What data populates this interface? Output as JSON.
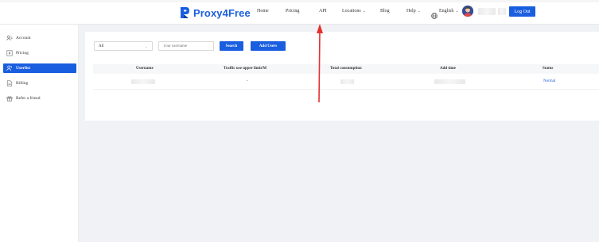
{
  "header": {
    "logo_text": "Proxy4Free",
    "nav": [
      {
        "label": "Home"
      },
      {
        "label": "Pricing"
      },
      {
        "label": "API"
      },
      {
        "label": "Locations"
      },
      {
        "label": "Blog"
      },
      {
        "label": "Help"
      }
    ],
    "language": "English",
    "logout_label": "Log Out"
  },
  "sidebar": {
    "items": [
      {
        "label": "Account",
        "icon": "account-icon"
      },
      {
        "label": "Pricing",
        "icon": "pricing-icon"
      },
      {
        "label": "Userlist",
        "icon": "users-icon",
        "active": true
      },
      {
        "label": "Billing",
        "icon": "billing-icon"
      },
      {
        "label": "Refer a friend",
        "icon": "gift-icon"
      }
    ]
  },
  "toolbar": {
    "filter_value": "All",
    "search_placeholder": "Your username",
    "search_label": "Search",
    "add_users_label": "Add Users"
  },
  "table": {
    "headers": [
      "Username",
      "Traffic use upper limit/M",
      "Total consumption",
      "Add time",
      "Status"
    ],
    "rows": [
      {
        "traffic_limit": "-",
        "status": "Normal"
      }
    ]
  },
  "colors": {
    "accent": "#1a5ee0",
    "arrow": "#e53030"
  }
}
